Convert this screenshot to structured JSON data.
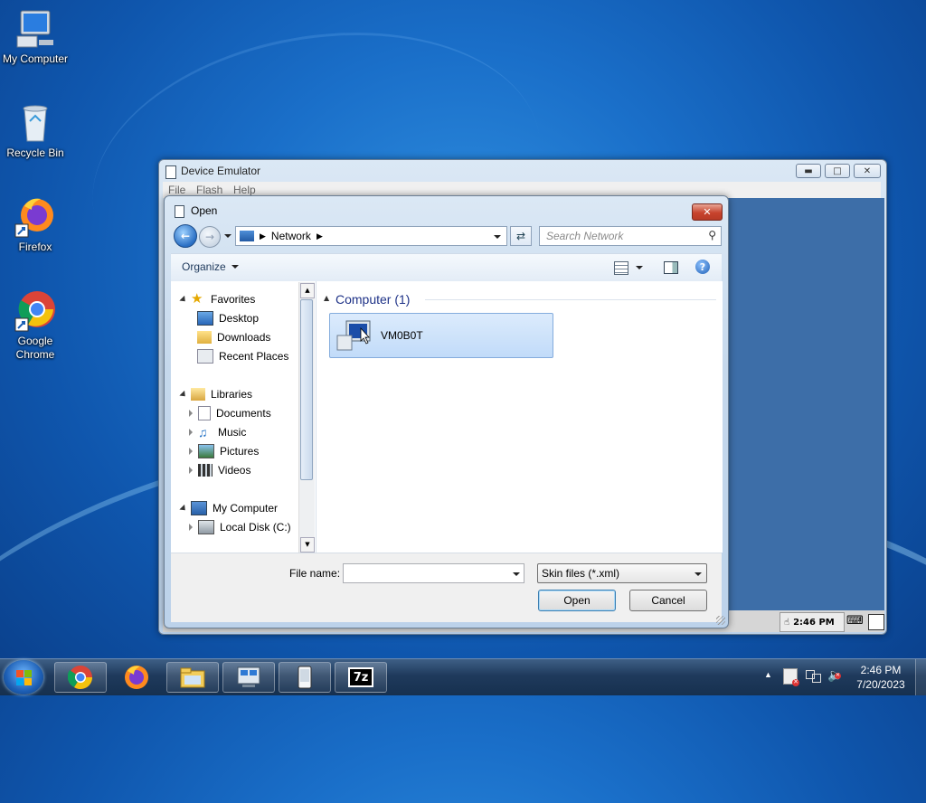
{
  "desktop": {
    "icons": [
      {
        "label": "My Computer"
      },
      {
        "label": "Recycle Bin"
      },
      {
        "label": "Firefox"
      },
      {
        "label": "Google Chrome"
      }
    ]
  },
  "emulator": {
    "title": "Device Emulator",
    "menu": [
      "File",
      "Flash",
      "Help"
    ],
    "status_time": "2:46 PM"
  },
  "dialog": {
    "title": "Open",
    "breadcrumb": "Network",
    "search_placeholder": "Search Network",
    "organize_label": "Organize",
    "nav": {
      "favorites": "Favorites",
      "desktop": "Desktop",
      "downloads": "Downloads",
      "recent": "Recent Places",
      "libraries": "Libraries",
      "documents": "Documents",
      "music": "Music",
      "pictures": "Pictures",
      "videos": "Videos",
      "computer": "My Computer",
      "localdisk": "Local Disk (C:)"
    },
    "group_header": "Computer (1)",
    "item_name": "VM0B0T",
    "filename_label": "File name:",
    "filename_value": "",
    "filetype": "Skin files (*.xml)",
    "open_label": "Open",
    "cancel_label": "Cancel"
  },
  "taskbar": {
    "clock_time": "2:46 PM",
    "clock_date": "7/20/2023",
    "sevenzip_label": "7z"
  }
}
